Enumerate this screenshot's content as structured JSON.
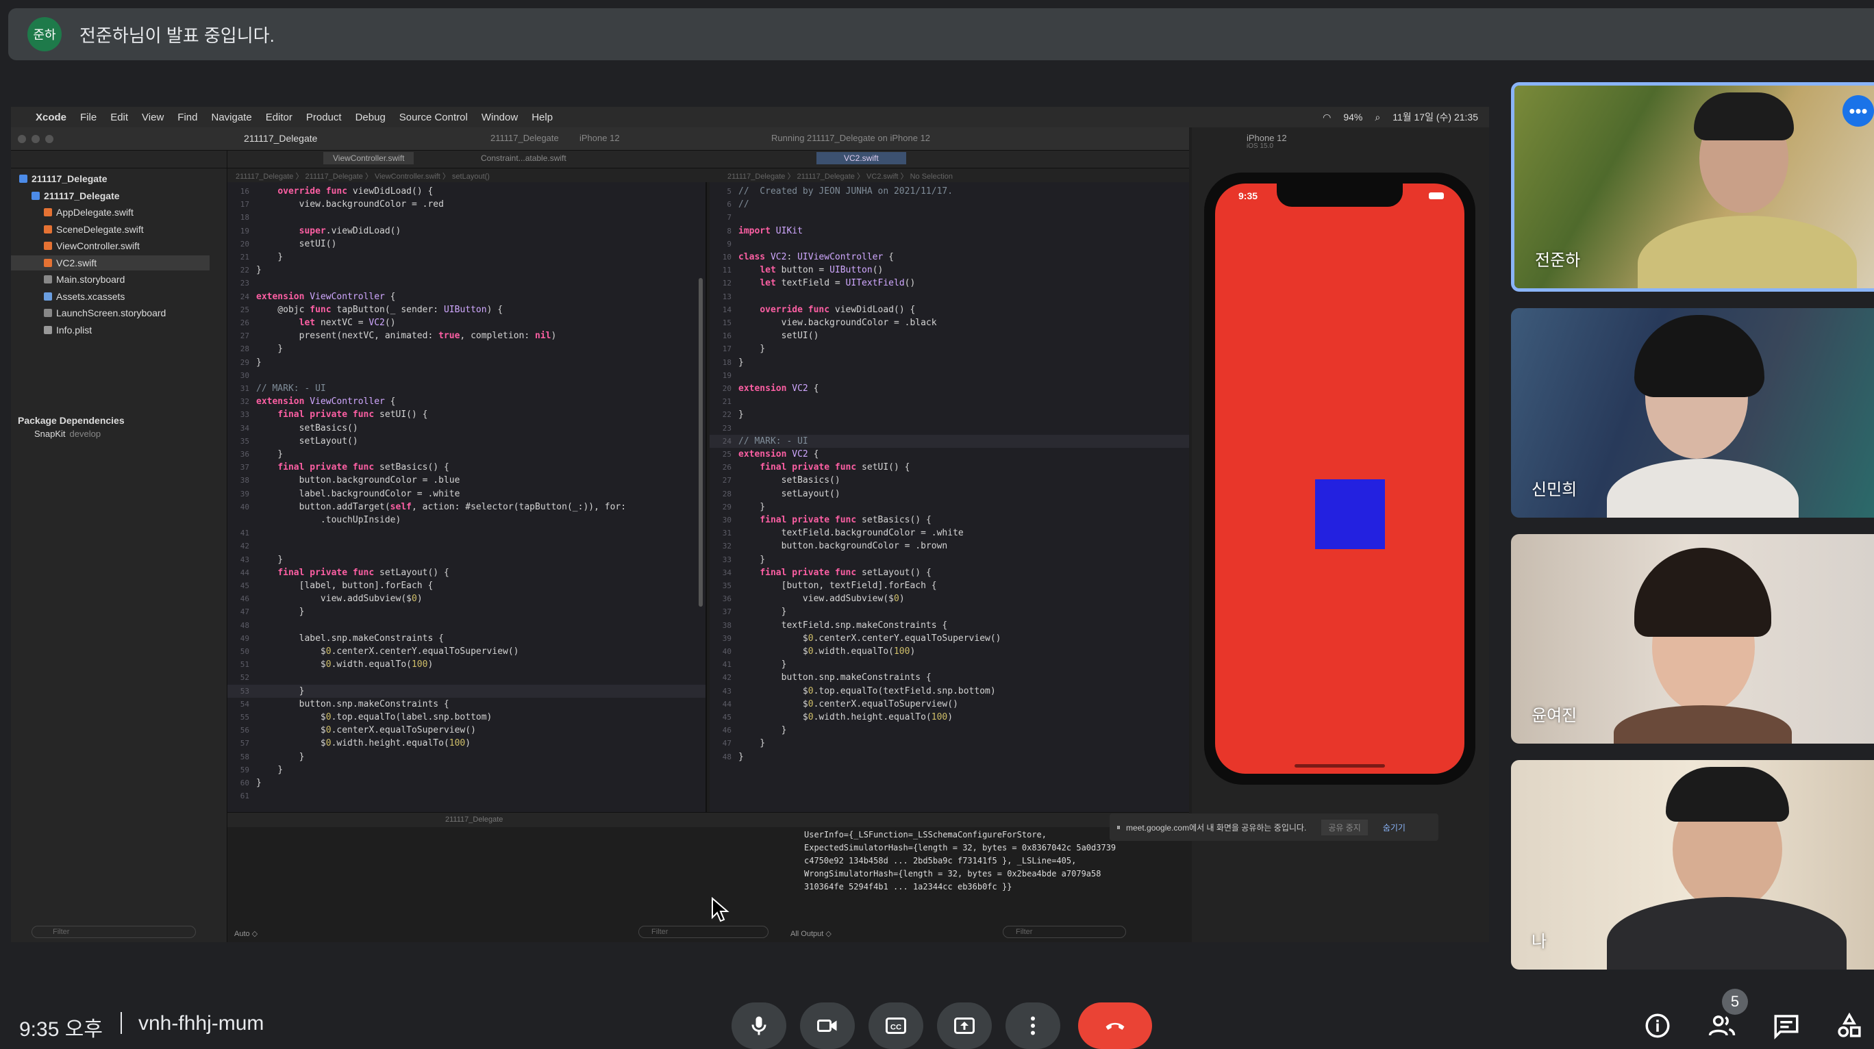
{
  "banner": {
    "avatar": "준하",
    "text": "전준하님이 발표 중입니다."
  },
  "xcode": {
    "menu": [
      "Xcode",
      "File",
      "Edit",
      "View",
      "Find",
      "Navigate",
      "Editor",
      "Product",
      "Debug",
      "Source Control",
      "Window",
      "Help"
    ],
    "status_right": {
      "battery": "94%",
      "datetime": "11월 17일 (수) 21:35"
    },
    "project_title": "211117_Delegate",
    "scheme": "211117_Delegate",
    "device": "iPhone 12",
    "status": "Running 211117_Delegate on iPhone 12",
    "tabs": [
      "ViewController.swift",
      "Constraint...atable.swift",
      "VC2.swift"
    ],
    "breadcrumb_left": "211117_Delegate 〉 211117_Delegate 〉 ViewController.swift 〉 setLayout()",
    "breadcrumb_right": "211117_Delegate 〉 211117_Delegate 〉 VC2.swift 〉 No Selection",
    "navigator": [
      {
        "label": "211117_Delegate",
        "indent": 0,
        "icon": "folder",
        "bold": true
      },
      {
        "label": "211117_Delegate",
        "indent": 1,
        "icon": "folder",
        "bold": true
      },
      {
        "label": "AppDelegate.swift",
        "indent": 2,
        "icon": "swift"
      },
      {
        "label": "SceneDelegate.swift",
        "indent": 2,
        "icon": "swift"
      },
      {
        "label": "ViewController.swift",
        "indent": 2,
        "icon": "swift"
      },
      {
        "label": "VC2.swift",
        "indent": 2,
        "icon": "swift",
        "selected": true
      },
      {
        "label": "Main.storyboard",
        "indent": 2,
        "icon": "sb"
      },
      {
        "label": "Assets.xcassets",
        "indent": 2,
        "icon": "xc"
      },
      {
        "label": "LaunchScreen.storyboard",
        "indent": 2,
        "icon": "sb"
      },
      {
        "label": "Info.plist",
        "indent": 2,
        "icon": "pl"
      }
    ],
    "package_title": "Package Dependencies",
    "package_item": "SnapKit",
    "package_branch": "develop",
    "filter_placeholder": "Filter",
    "left_code": [
      {
        "n": "16",
        "t": "    override func viewDidLoad() {"
      },
      {
        "n": "17",
        "t": "        view.backgroundColor = .red"
      },
      {
        "n": "18",
        "t": ""
      },
      {
        "n": "19",
        "t": "        super.viewDidLoad()"
      },
      {
        "n": "20",
        "t": "        setUI()"
      },
      {
        "n": "21",
        "t": "    }"
      },
      {
        "n": "22",
        "t": "}"
      },
      {
        "n": "23",
        "t": ""
      },
      {
        "n": "24",
        "t": "extension ViewController {"
      },
      {
        "n": "25",
        "t": "    @objc func tapButton(_ sender: UIButton) {"
      },
      {
        "n": "26",
        "t": "        let nextVC = VC2()"
      },
      {
        "n": "27",
        "t": "        present(nextVC, animated: true, completion: nil)"
      },
      {
        "n": "28",
        "t": "    }"
      },
      {
        "n": "29",
        "t": "}"
      },
      {
        "n": "30",
        "t": ""
      },
      {
        "n": "31",
        "t": "// MARK: - UI"
      },
      {
        "n": "32",
        "t": "extension ViewController {"
      },
      {
        "n": "33",
        "t": "    final private func setUI() {"
      },
      {
        "n": "34",
        "t": "        setBasics()"
      },
      {
        "n": "35",
        "t": "        setLayout()"
      },
      {
        "n": "36",
        "t": "    }"
      },
      {
        "n": "37",
        "t": "    final private func setBasics() {"
      },
      {
        "n": "38",
        "t": "        button.backgroundColor = .blue"
      },
      {
        "n": "39",
        "t": "        label.backgroundColor = .white"
      },
      {
        "n": "40",
        "t": "        button.addTarget(self, action: #selector(tapButton(_:)), for:"
      },
      {
        "n": "",
        "t": "            .touchUpInside)"
      },
      {
        "n": "41",
        "t": ""
      },
      {
        "n": "42",
        "t": ""
      },
      {
        "n": "43",
        "t": "    }"
      },
      {
        "n": "44",
        "t": "    final private func setLayout() {"
      },
      {
        "n": "45",
        "t": "        [label, button].forEach {"
      },
      {
        "n": "46",
        "t": "            view.addSubview($0)"
      },
      {
        "n": "47",
        "t": "        }"
      },
      {
        "n": "48",
        "t": ""
      },
      {
        "n": "49",
        "t": "        label.snp.makeConstraints {"
      },
      {
        "n": "50",
        "t": "            $0.centerX.centerY.equalToSuperview()"
      },
      {
        "n": "51",
        "t": "            $0.width.equalTo(100)"
      },
      {
        "n": "52",
        "t": ""
      },
      {
        "n": "53",
        "t": "        }"
      },
      {
        "n": "54",
        "t": "        button.snp.makeConstraints {"
      },
      {
        "n": "55",
        "t": "            $0.top.equalTo(label.snp.bottom)"
      },
      {
        "n": "56",
        "t": "            $0.centerX.equalToSuperview()"
      },
      {
        "n": "57",
        "t": "            $0.width.height.equalTo(100)"
      },
      {
        "n": "58",
        "t": "        }"
      },
      {
        "n": "59",
        "t": "    }"
      },
      {
        "n": "60",
        "t": "}"
      },
      {
        "n": "61",
        "t": ""
      }
    ],
    "right_code": [
      {
        "n": "5",
        "t": "//  Created by JEON JUNHA on 2021/11/17."
      },
      {
        "n": "6",
        "t": "//"
      },
      {
        "n": "7",
        "t": ""
      },
      {
        "n": "8",
        "t": "import UIKit"
      },
      {
        "n": "9",
        "t": ""
      },
      {
        "n": "10",
        "t": "class VC2: UIViewController {"
      },
      {
        "n": "11",
        "t": "    let button = UIButton()"
      },
      {
        "n": "12",
        "t": "    let textField = UITextField()"
      },
      {
        "n": "13",
        "t": ""
      },
      {
        "n": "14",
        "t": "    override func viewDidLoad() {"
      },
      {
        "n": "15",
        "t": "        view.backgroundColor = .black"
      },
      {
        "n": "16",
        "t": "        setUI()"
      },
      {
        "n": "17",
        "t": "    }"
      },
      {
        "n": "18",
        "t": "}"
      },
      {
        "n": "19",
        "t": ""
      },
      {
        "n": "20",
        "t": "extension VC2 {"
      },
      {
        "n": "21",
        "t": ""
      },
      {
        "n": "22",
        "t": "}"
      },
      {
        "n": "23",
        "t": ""
      },
      {
        "n": "24",
        "t": "// MARK: - UI"
      },
      {
        "n": "25",
        "t": "extension VC2 {"
      },
      {
        "n": "26",
        "t": "    final private func setUI() {"
      },
      {
        "n": "27",
        "t": "        setBasics()"
      },
      {
        "n": "28",
        "t": "        setLayout()"
      },
      {
        "n": "29",
        "t": "    }"
      },
      {
        "n": "30",
        "t": "    final private func setBasics() {"
      },
      {
        "n": "31",
        "t": "        textField.backgroundColor = .white"
      },
      {
        "n": "32",
        "t": "        button.backgroundColor = .brown"
      },
      {
        "n": "33",
        "t": "    }"
      },
      {
        "n": "34",
        "t": "    final private func setLayout() {"
      },
      {
        "n": "35",
        "t": "        [button, textField].forEach {"
      },
      {
        "n": "36",
        "t": "            view.addSubview($0)"
      },
      {
        "n": "37",
        "t": "        }"
      },
      {
        "n": "38",
        "t": "        textField.snp.makeConstraints {"
      },
      {
        "n": "39",
        "t": "            $0.centerX.centerY.equalToSuperview()"
      },
      {
        "n": "40",
        "t": "            $0.width.equalTo(100)"
      },
      {
        "n": "41",
        "t": "        }"
      },
      {
        "n": "42",
        "t": "        button.snp.makeConstraints {"
      },
      {
        "n": "43",
        "t": "            $0.top.equalTo(textField.snp.bottom)"
      },
      {
        "n": "44",
        "t": "            $0.centerX.equalToSuperview()"
      },
      {
        "n": "45",
        "t": "            $0.width.height.equalTo(100)"
      },
      {
        "n": "46",
        "t": "        }"
      },
      {
        "n": "47",
        "t": "    }"
      },
      {
        "n": "48",
        "t": "}"
      }
    ],
    "debug_title": "211117_Delegate",
    "auto_label": "Auto ◇",
    "all_output_label": "All Output ◇",
    "log_lines": [
      "UserInfo={_LSFunction=_LSSchemaConfigureForStore,",
      "ExpectedSimulatorHash={length = 32, bytes = 0x8367042c 5a0d3739",
      "c4750e92 134b458d ... 2bd5ba9c f73141f5 }, _LSLine=405,",
      "WrongSimulatorHash={length = 32, bytes = 0x2bea4bde a7079a58",
      "310364fe 5294f4b1 ... 1a2344cc eb36b0fc }}"
    ]
  },
  "simulator": {
    "title": "iPhone 12",
    "os": "iOS 15.0",
    "phone_time": "9:35",
    "bg_color": "#e8362a",
    "box_color": "#2321e0"
  },
  "share_notice": {
    "message": "meet.google.com에서 내 화면을 공유하는 중입니다.",
    "stop": "공유 중지",
    "hide": "숨기기"
  },
  "participants": [
    {
      "name": "전준하",
      "active": true
    },
    {
      "name": "신민희"
    },
    {
      "name": "윤여진"
    },
    {
      "name": "나"
    }
  ],
  "bottom": {
    "time": "9:35 오후",
    "meeting_code": "vnh-fhhj-mum",
    "people_count": "5"
  }
}
